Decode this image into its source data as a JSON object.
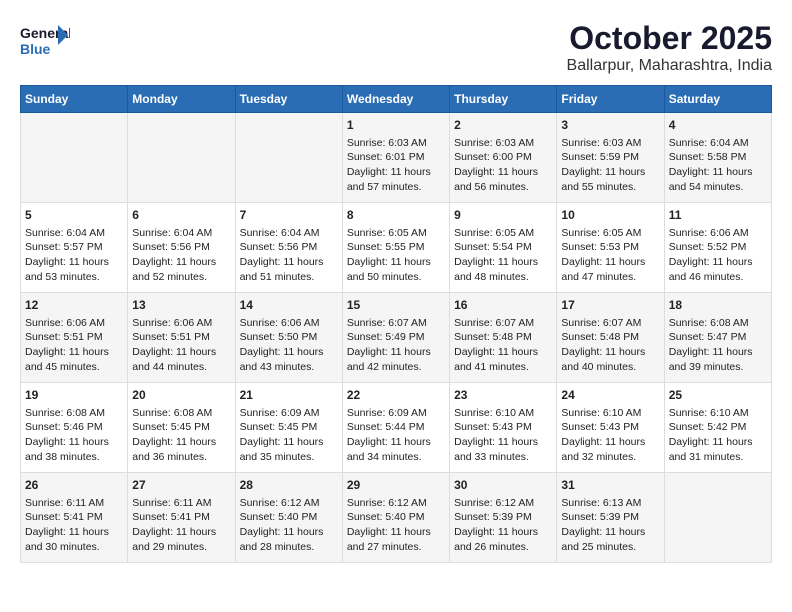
{
  "header": {
    "logo_general": "General",
    "logo_blue": "Blue",
    "title": "October 2025",
    "subtitle": "Ballarpur, Maharashtra, India"
  },
  "weekdays": [
    "Sunday",
    "Monday",
    "Tuesday",
    "Wednesday",
    "Thursday",
    "Friday",
    "Saturday"
  ],
  "weeks": [
    [
      {
        "day": "",
        "info": ""
      },
      {
        "day": "",
        "info": ""
      },
      {
        "day": "",
        "info": ""
      },
      {
        "day": "1",
        "info": "Sunrise: 6:03 AM\nSunset: 6:01 PM\nDaylight: 11 hours\nand 57 minutes."
      },
      {
        "day": "2",
        "info": "Sunrise: 6:03 AM\nSunset: 6:00 PM\nDaylight: 11 hours\nand 56 minutes."
      },
      {
        "day": "3",
        "info": "Sunrise: 6:03 AM\nSunset: 5:59 PM\nDaylight: 11 hours\nand 55 minutes."
      },
      {
        "day": "4",
        "info": "Sunrise: 6:04 AM\nSunset: 5:58 PM\nDaylight: 11 hours\nand 54 minutes."
      }
    ],
    [
      {
        "day": "5",
        "info": "Sunrise: 6:04 AM\nSunset: 5:57 PM\nDaylight: 11 hours\nand 53 minutes."
      },
      {
        "day": "6",
        "info": "Sunrise: 6:04 AM\nSunset: 5:56 PM\nDaylight: 11 hours\nand 52 minutes."
      },
      {
        "day": "7",
        "info": "Sunrise: 6:04 AM\nSunset: 5:56 PM\nDaylight: 11 hours\nand 51 minutes."
      },
      {
        "day": "8",
        "info": "Sunrise: 6:05 AM\nSunset: 5:55 PM\nDaylight: 11 hours\nand 50 minutes."
      },
      {
        "day": "9",
        "info": "Sunrise: 6:05 AM\nSunset: 5:54 PM\nDaylight: 11 hours\nand 48 minutes."
      },
      {
        "day": "10",
        "info": "Sunrise: 6:05 AM\nSunset: 5:53 PM\nDaylight: 11 hours\nand 47 minutes."
      },
      {
        "day": "11",
        "info": "Sunrise: 6:06 AM\nSunset: 5:52 PM\nDaylight: 11 hours\nand 46 minutes."
      }
    ],
    [
      {
        "day": "12",
        "info": "Sunrise: 6:06 AM\nSunset: 5:51 PM\nDaylight: 11 hours\nand 45 minutes."
      },
      {
        "day": "13",
        "info": "Sunrise: 6:06 AM\nSunset: 5:51 PM\nDaylight: 11 hours\nand 44 minutes."
      },
      {
        "day": "14",
        "info": "Sunrise: 6:06 AM\nSunset: 5:50 PM\nDaylight: 11 hours\nand 43 minutes."
      },
      {
        "day": "15",
        "info": "Sunrise: 6:07 AM\nSunset: 5:49 PM\nDaylight: 11 hours\nand 42 minutes."
      },
      {
        "day": "16",
        "info": "Sunrise: 6:07 AM\nSunset: 5:48 PM\nDaylight: 11 hours\nand 41 minutes."
      },
      {
        "day": "17",
        "info": "Sunrise: 6:07 AM\nSunset: 5:48 PM\nDaylight: 11 hours\nand 40 minutes."
      },
      {
        "day": "18",
        "info": "Sunrise: 6:08 AM\nSunset: 5:47 PM\nDaylight: 11 hours\nand 39 minutes."
      }
    ],
    [
      {
        "day": "19",
        "info": "Sunrise: 6:08 AM\nSunset: 5:46 PM\nDaylight: 11 hours\nand 38 minutes."
      },
      {
        "day": "20",
        "info": "Sunrise: 6:08 AM\nSunset: 5:45 PM\nDaylight: 11 hours\nand 36 minutes."
      },
      {
        "day": "21",
        "info": "Sunrise: 6:09 AM\nSunset: 5:45 PM\nDaylight: 11 hours\nand 35 minutes."
      },
      {
        "day": "22",
        "info": "Sunrise: 6:09 AM\nSunset: 5:44 PM\nDaylight: 11 hours\nand 34 minutes."
      },
      {
        "day": "23",
        "info": "Sunrise: 6:10 AM\nSunset: 5:43 PM\nDaylight: 11 hours\nand 33 minutes."
      },
      {
        "day": "24",
        "info": "Sunrise: 6:10 AM\nSunset: 5:43 PM\nDaylight: 11 hours\nand 32 minutes."
      },
      {
        "day": "25",
        "info": "Sunrise: 6:10 AM\nSunset: 5:42 PM\nDaylight: 11 hours\nand 31 minutes."
      }
    ],
    [
      {
        "day": "26",
        "info": "Sunrise: 6:11 AM\nSunset: 5:41 PM\nDaylight: 11 hours\nand 30 minutes."
      },
      {
        "day": "27",
        "info": "Sunrise: 6:11 AM\nSunset: 5:41 PM\nDaylight: 11 hours\nand 29 minutes."
      },
      {
        "day": "28",
        "info": "Sunrise: 6:12 AM\nSunset: 5:40 PM\nDaylight: 11 hours\nand 28 minutes."
      },
      {
        "day": "29",
        "info": "Sunrise: 6:12 AM\nSunset: 5:40 PM\nDaylight: 11 hours\nand 27 minutes."
      },
      {
        "day": "30",
        "info": "Sunrise: 6:12 AM\nSunset: 5:39 PM\nDaylight: 11 hours\nand 26 minutes."
      },
      {
        "day": "31",
        "info": "Sunrise: 6:13 AM\nSunset: 5:39 PM\nDaylight: 11 hours\nand 25 minutes."
      },
      {
        "day": "",
        "info": ""
      }
    ]
  ]
}
